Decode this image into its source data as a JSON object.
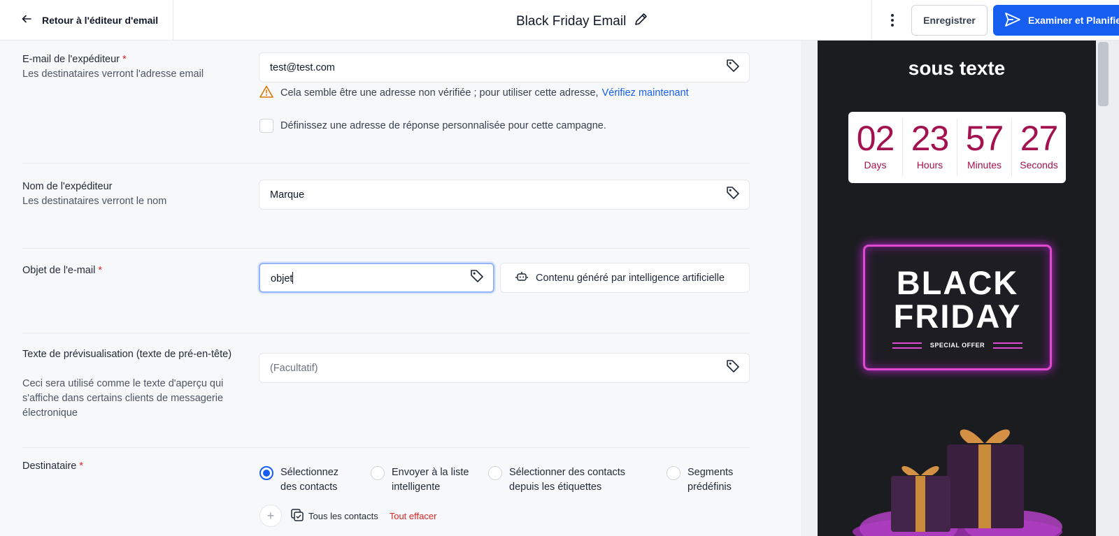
{
  "header": {
    "back_label": "Retour à l'éditeur d'email",
    "title": "Black Friday Email",
    "save_label": "Enregistrer",
    "review_label": "Examiner et Planifier"
  },
  "form": {
    "sender_email": {
      "label": "E-mail de l'expéditeur",
      "required_mark": "*",
      "help": "Les destinataires verront l'adresse email",
      "value": "test@test.com",
      "warning": "Cela semble être une adresse non vérifiée ; pour utiliser cette adresse,",
      "verify_link": "Vérifiez maintenant",
      "custom_reply_label": "Définissez une adresse de réponse personnalisée pour cette campagne."
    },
    "sender_name": {
      "label": "Nom de l'expéditeur",
      "help": "Les destinataires verront le nom",
      "value": "Marque"
    },
    "subject": {
      "label": "Objet de l'e-mail",
      "required_mark": "*",
      "value": "objet",
      "ai_button": "Contenu généré par intelligence artificielle"
    },
    "preview_text": {
      "label": "Texte de prévisualisation (texte de pré-en-tête)",
      "help": "Ceci sera utilisé comme le texte d'aperçu qui s'affiche dans certains clients de messagerie électronique",
      "placeholder": "(Facultatif)"
    },
    "recipient": {
      "label": "Destinataire",
      "required_mark": "*",
      "options": [
        "Sélectionnez des contacts",
        "Envoyer à la liste intelligente",
        "Sélectionner des contacts depuis les étiquettes",
        "Segments prédéfinis"
      ],
      "selected_index": 0,
      "all_contacts": "Tous les contacts",
      "clear_all": "Tout effacer"
    }
  },
  "preview": {
    "heading": "sous texte",
    "countdown": [
      {
        "value": "02",
        "unit": "Days"
      },
      {
        "value": "23",
        "unit": "Hours"
      },
      {
        "value": "57",
        "unit": "Minutes"
      },
      {
        "value": "27",
        "unit": "Seconds"
      }
    ],
    "banner_line1": "BLACK",
    "banner_line2": "FRIDAY",
    "banner_offer": "SPECIAL OFFER"
  },
  "colors": {
    "primary": "#155eef",
    "required": "#dc2626",
    "warning": "#d97706",
    "countdown": "#a3114f",
    "neon": "#e04ad1"
  },
  "icons": [
    "arrow-left-icon",
    "pencil-icon",
    "kebab-menu-icon",
    "send-icon",
    "tag-icon",
    "warning-icon",
    "robot-icon",
    "plus-icon",
    "contacts-icon"
  ]
}
